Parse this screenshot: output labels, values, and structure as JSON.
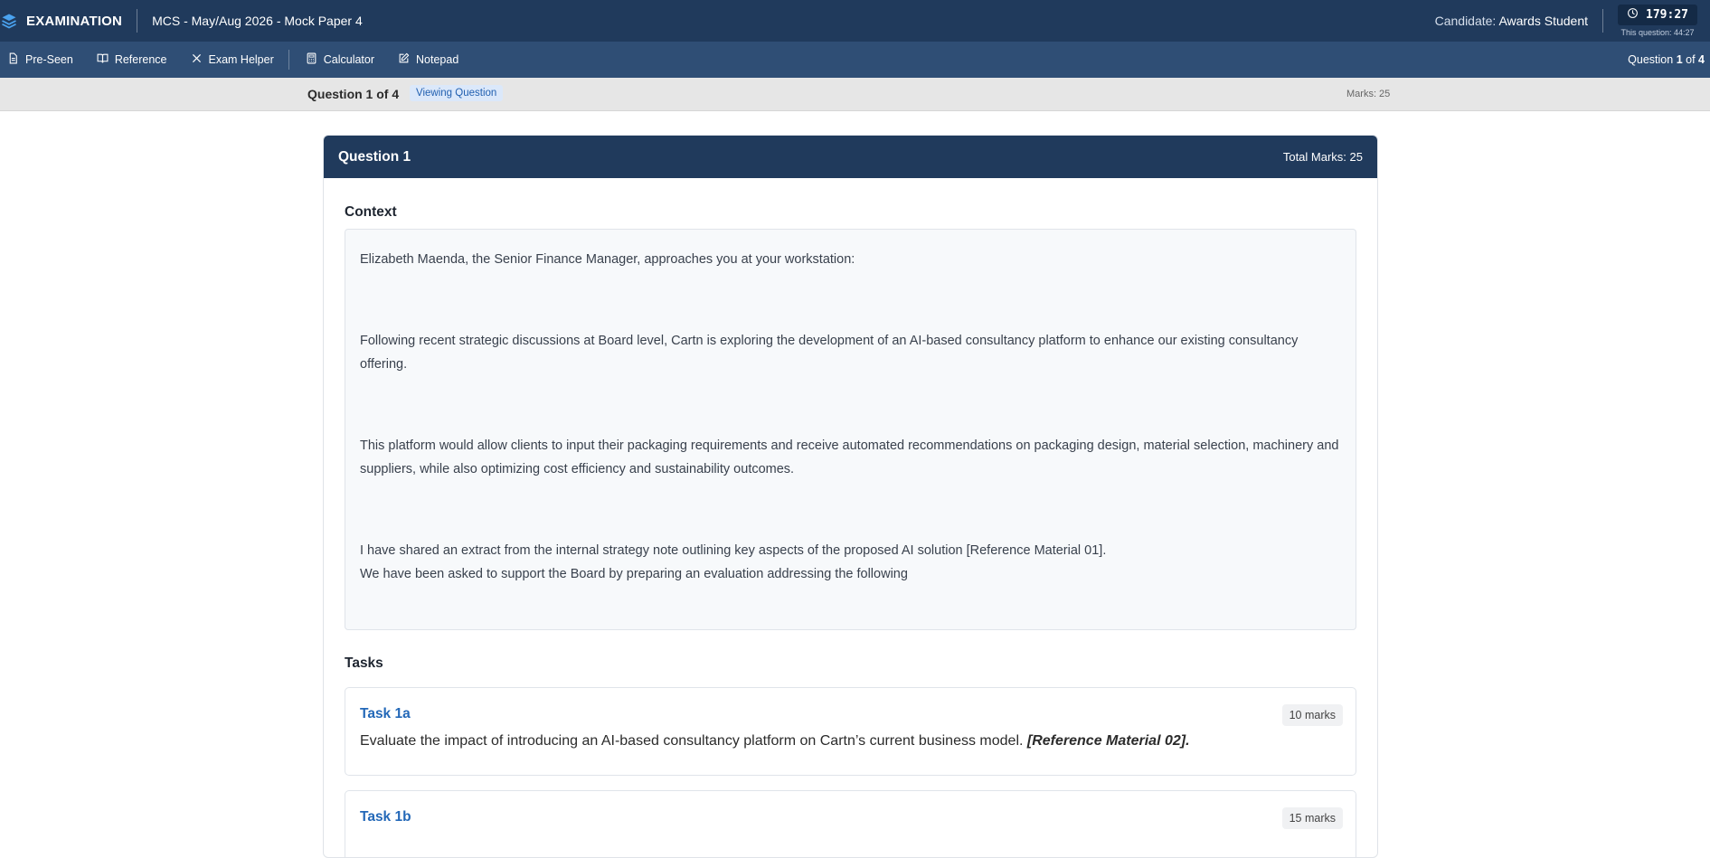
{
  "header": {
    "brand": "EXAMINATION",
    "exam_title": "MCS - May/Aug 2026 - Mock Paper 4",
    "candidate_label": "Candidate:",
    "candidate_name": "Awards Student",
    "timer": "179:27",
    "timer_sub": "This question: 44:27"
  },
  "toolbar": {
    "items": [
      {
        "label": "Pre-Seen",
        "icon": "document-icon"
      },
      {
        "label": "Reference",
        "icon": "book-icon"
      },
      {
        "label": "Exam Helper",
        "icon": "close-icon"
      },
      {
        "label": "Calculator",
        "icon": "calculator-icon"
      },
      {
        "label": "Notepad",
        "icon": "edit-icon"
      }
    ],
    "question_prefix": "Question",
    "question_current": "1",
    "question_of": "of",
    "question_total": "4"
  },
  "strip": {
    "question": "Question 1 of 4",
    "badge": "Viewing Question",
    "marks": "Marks: 25"
  },
  "question": {
    "title": "Question 1",
    "total_marks": "Total Marks: 25",
    "context_label": "Context",
    "context": [
      "Elizabeth Maenda, the Senior Finance Manager, approaches you at your workstation:",
      "Following recent strategic discussions at Board level, Cartn is exploring the development of an AI-based consultancy platform to enhance our existing consultancy offering.",
      "This platform would allow clients to input their packaging requirements and receive automated recommendations on packaging design, material selection, machinery and suppliers, while also optimizing cost efficiency and sustainability outcomes.",
      "I have shared an extract from the internal strategy note outlining key aspects of the proposed AI solution [Reference Material 01].",
      "We have been asked to support the Board by preparing an evaluation addressing the following"
    ],
    "tasks_label": "Tasks",
    "tasks": [
      {
        "title": "Task 1a",
        "marks": "10 marks",
        "text": "Evaluate the impact of introducing an AI-based consultancy platform on Cartn’s current business model.",
        "ref": "[Reference Material 02]."
      },
      {
        "title": "Task 1b",
        "marks": "15 marks",
        "text": "",
        "ref": ""
      }
    ]
  },
  "colors": {
    "header_bg": "#203a5c",
    "toolbar_bg": "#2f4e75",
    "accent_link": "#2368b8",
    "badge_bg": "#dbe8fa"
  }
}
